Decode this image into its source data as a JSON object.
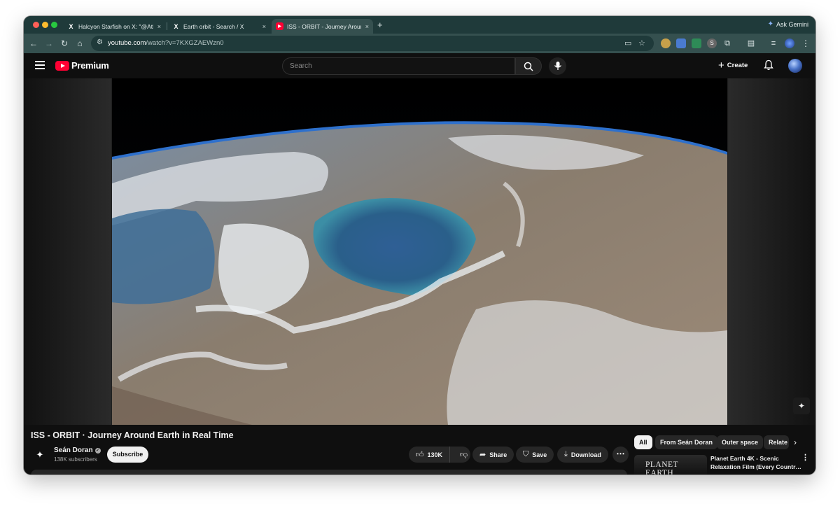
{
  "browser": {
    "tabs": [
      {
        "label": "Halcyon Starfish on X: \"@Atla",
        "favicon": "X"
      },
      {
        "label": "Earth orbit - Search / X",
        "favicon": "X"
      },
      {
        "label": "ISS - ORBIT - Journey Around",
        "favicon": "▶"
      }
    ],
    "close_glyph": "×",
    "new_tab": "+",
    "ask_gemini": "Ask Gemini",
    "url_host": "youtube.com",
    "url_path": "/watch?v=7KXGZAEWzn0"
  },
  "youtube": {
    "logo_text": "Premium",
    "search_placeholder": "Search",
    "create_label": "Create"
  },
  "video": {
    "title": "ISS - ORBIT · Journey Around Earth in Real Time",
    "channel": "Seán Doran",
    "subscribers": "138K subscribers",
    "subscribe_label": "Subscribe",
    "likes": "130K",
    "share_label": "Share",
    "save_label": "Save",
    "download_label": "Download"
  },
  "chips": [
    "All",
    "From Seán Doran",
    "Outer space",
    "Relate"
  ],
  "recommendation": {
    "thumb_text": "PLANET EARTH",
    "title_line1": "Planet Earth 4K - Scenic",
    "title_line2": "Relaxation Film (Every Country..."
  },
  "colors": {
    "tab_strip": "#1f3a3a",
    "toolbar": "#35504f",
    "youtube_red": "#ff0033",
    "yt_background": "#0f0f0f",
    "chip_bg": "#272727"
  }
}
